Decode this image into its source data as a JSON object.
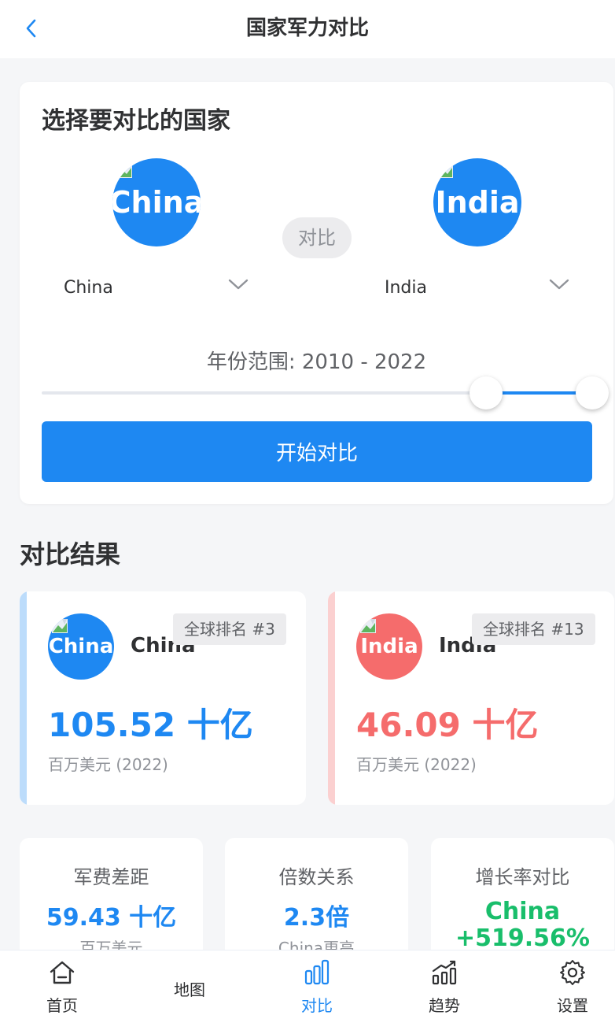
{
  "header": {
    "title": "国家军力对比"
  },
  "selector": {
    "section_title": "选择要对比的国家",
    "country_a": {
      "flag_text": "China",
      "selected": "China",
      "color": "#1e88f2"
    },
    "country_b": {
      "flag_text": "India",
      "selected": "India",
      "color": "#1e88f2"
    },
    "vs_label": "对比",
    "year_range_label": "年份范围: 2010 - 2022",
    "start_button": "开始对比"
  },
  "results": {
    "section_title": "对比结果",
    "cards": [
      {
        "flag_text": "China",
        "name": "China",
        "rank": "全球排名 #3",
        "value": "105.52 十亿",
        "unit": "百万美元 (2022)",
        "color": "#1e88f2",
        "accent": "#bcdcfb"
      },
      {
        "flag_text": "India",
        "name": "India",
        "rank": "全球排名 #13",
        "value": "46.09 十亿",
        "unit": "百万美元 (2022)",
        "color": "#f56c6c",
        "accent": "#fbd0d0"
      }
    ],
    "stats": [
      {
        "label": "军费差距",
        "value": "59.43 十亿",
        "sub": "百万美元"
      },
      {
        "label": "倍数关系",
        "value": "2.3倍",
        "sub": "China更高"
      },
      {
        "label": "增长率对比",
        "value": "China",
        "sub": "+519.56%"
      }
    ]
  },
  "tabbar": {
    "items": [
      {
        "label": "首页",
        "icon": "home-icon"
      },
      {
        "label": "地图",
        "icon": "map-icon"
      },
      {
        "label": "对比",
        "icon": "bar-chart-icon"
      },
      {
        "label": "趋势",
        "icon": "trend-icon"
      },
      {
        "label": "设置",
        "icon": "gear-icon"
      }
    ],
    "active": "对比"
  }
}
